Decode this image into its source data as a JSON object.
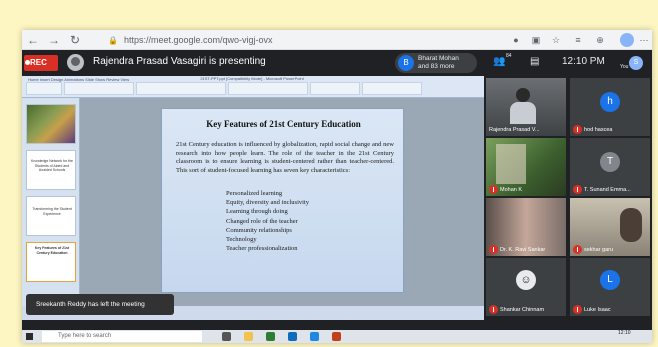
{
  "browser": {
    "url": "https://meet.google.com/qwo-vigj-ovx",
    "nav": {
      "back": "←",
      "forward": "→",
      "reload": "↻"
    },
    "icons": [
      "mic-icon",
      "camera-icon",
      "star-icon",
      "extensions-icon",
      "collections-icon",
      "profile-icon",
      "menu-icon"
    ],
    "profile_initial": ""
  },
  "meet_header": {
    "rec_label": "REC",
    "presenting_text": "Rajendra Prasad Vasagiri is presenting",
    "participants_chip": {
      "initial": "B",
      "line1": "Bharat Mohan",
      "line2": "and 83 more"
    },
    "people_count": "84",
    "time": "12:10 PM",
    "you_label": "You",
    "you_initial": "S"
  },
  "powerpoint": {
    "window_title": "21ST-PPT.ppt [Compatibility Mode] - Microsoft PowerPoint",
    "tabs": "Home   Insert   Design   Animations   Slide Show   Review   View",
    "thumb_texts": [
      "Knowledge Network for the Students of Aided and Unaided Schools",
      "Transforming the Student Experience",
      "Key Features of 21st Century Education"
    ]
  },
  "slide": {
    "title": "Key Features of 21st Century Education",
    "body": "21st Century education is influenced by globalization, rapid social change and new research into how people learn. The role of the teacher in the 21st Century classroom is to ensure learning is student-centered rather than teacher-centered. This sort of student-focused learning has seven key characteristics:",
    "points": [
      "Personalized learning",
      "Equity, diversity and inclusivity",
      "Learning through doing",
      "Changed role of the teacher",
      "Community relationships",
      "Technology",
      "Teacher professionalization"
    ]
  },
  "toast": "Sreekanth Reddy has left the meeting",
  "participants": [
    {
      "name": "Rajendra Prasad V...",
      "kind": "video"
    },
    {
      "name": "hod hascea",
      "initial": "h",
      "color": "#1a73e8"
    },
    {
      "name": "Mohan K",
      "kind": "video"
    },
    {
      "name": "T. Sunand Emma...",
      "initial": "T",
      "color": "#80868b"
    },
    {
      "name": "Dr. K. Ravi Sankar",
      "kind": "video"
    },
    {
      "name": "sekhar garu",
      "kind": "video"
    },
    {
      "name": "Shankar Chinnam",
      "kind": "photo"
    },
    {
      "name": "Luke Isaac",
      "initial": "L",
      "color": "#1a73e8"
    }
  ],
  "taskbar": {
    "search_placeholder": "Type here to search",
    "time": "12:10"
  },
  "colors": {
    "rec": "#d93025",
    "meet_bg": "#202124",
    "accent": "#1a73e8",
    "page_bg": "#fdf6c2"
  }
}
